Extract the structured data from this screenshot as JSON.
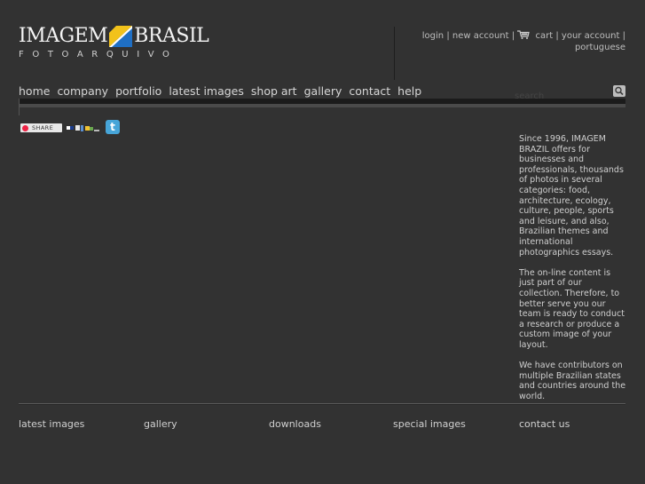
{
  "logo": {
    "word_left": "IMAGEM",
    "word_right": "BRASIL",
    "subtitle": "FOTOARQUIVO"
  },
  "account": {
    "login": "login",
    "new_account": "new account",
    "cart": "cart",
    "your_account": "your account",
    "language": "portuguese",
    "separator": "|"
  },
  "nav": {
    "items": [
      {
        "label": "home"
      },
      {
        "label": "company"
      },
      {
        "label": "portfolio"
      },
      {
        "label": "latest images"
      },
      {
        "label": "shop art"
      },
      {
        "label": "gallery"
      },
      {
        "label": "contact"
      },
      {
        "label": "help"
      }
    ]
  },
  "search": {
    "placeholder": "search"
  },
  "share": {
    "label": "SHARE"
  },
  "description": {
    "paragraphs": [
      "Since 1996, IMAGEM BRAZIL offers for businesses and professionals, thousands of photos in several categories: food, architecture, ecology, culture, people, sports and leisure, and also, Brazilian themes and international photographics essays.",
      "The on-line content is just part of our collection. Therefore, to better serve you our team is ready to conduct a research or produce a custom image of your layout.",
      "We have contributors on multiple Brazilian states and countries around the world."
    ]
  },
  "footer": {
    "links": [
      {
        "label": "latest images"
      },
      {
        "label": "gallery"
      },
      {
        "label": "downloads"
      },
      {
        "label": "special images"
      },
      {
        "label": "contact us"
      }
    ]
  },
  "colors": {
    "background": "#323232",
    "text": "#d0d0d0",
    "flag_blue": "#1f6fc4",
    "flag_yellow": "#f2c21b",
    "twitter": "#47a5d8"
  },
  "icons": {
    "cart": "shopping-cart-icon",
    "search": "magnifier-icon",
    "twitter": "twitter-icon",
    "share": "share-icon"
  }
}
